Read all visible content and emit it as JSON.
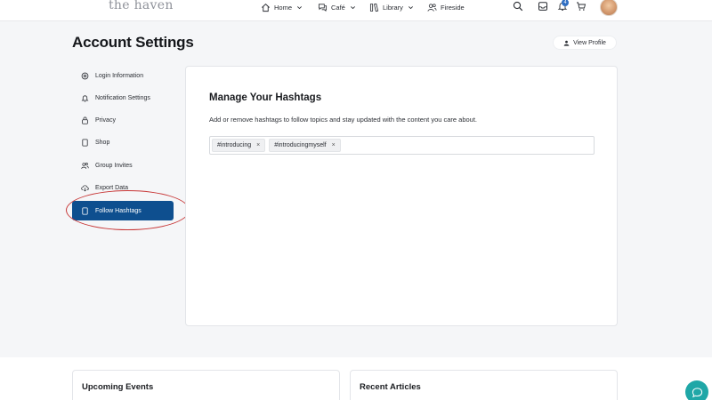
{
  "app": {
    "logo_text": "the haven"
  },
  "nav": {
    "home": {
      "label": "Home",
      "icon": "home-icon"
    },
    "cafe": {
      "label": "Café",
      "icon": "chat-bubbles-icon"
    },
    "library": {
      "label": "Library",
      "icon": "books-icon"
    },
    "fireside": {
      "label": "Fireside",
      "icon": "people-icon"
    },
    "notification_count": "4"
  },
  "page": {
    "title": "Account Settings",
    "view_profile": "View Profile"
  },
  "sidebar": {
    "items": [
      {
        "label": "Login Information",
        "icon": "gear-icon"
      },
      {
        "label": "Notification Settings",
        "icon": "bell-icon"
      },
      {
        "label": "Privacy",
        "icon": "lock-icon"
      },
      {
        "label": "Shop",
        "icon": "page-icon"
      },
      {
        "label": "Group Invites",
        "icon": "group-icon"
      },
      {
        "label": "Export Data",
        "icon": "cloud-download-icon"
      },
      {
        "label": "Follow Hashtags",
        "icon": "page-icon",
        "active": true
      }
    ]
  },
  "main": {
    "title": "Manage Your Hashtags",
    "description": "Add or remove hashtags to follow topics and stay updated with the content you care about.",
    "tags": [
      {
        "label": "#introducing",
        "remove": "×"
      },
      {
        "label": "#introducingmyself",
        "remove": "×"
      }
    ]
  },
  "bottom": {
    "events_title": "Upcoming Events",
    "articles_title": "Recent Articles"
  },
  "colors": {
    "accent": "#0e4f8f",
    "annotation": "#c73535",
    "chat": "#1fa7a7",
    "badge": "#2f6ec2"
  }
}
